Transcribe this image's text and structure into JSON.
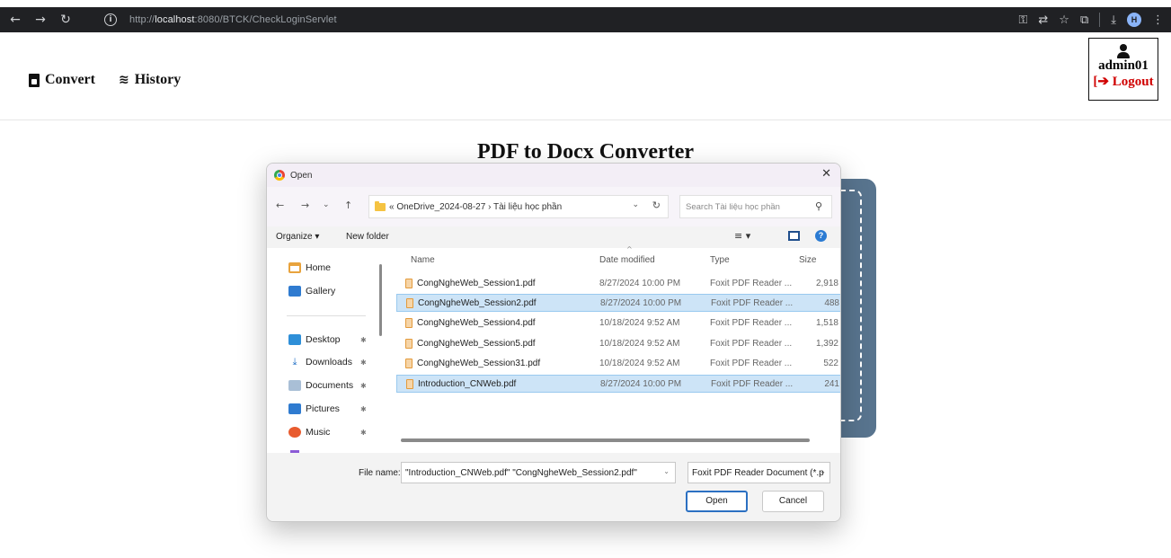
{
  "browser": {
    "url_prefix": "http://",
    "url_host": "localhost",
    "url_rest": ":8080/BTCK/CheckLoginServlet",
    "profile_initial": "H"
  },
  "nav": {
    "convert_label": "Convert",
    "history_label": "History"
  },
  "user": {
    "username": "admin01",
    "logout_label": "Logout"
  },
  "page": {
    "title": "PDF to Docx Converter"
  },
  "dialog": {
    "title": "Open",
    "path": "« OneDrive_2024-08-27 › Tài liệu học phần",
    "search_placeholder": "Search Tài liệu học phần",
    "organize_label": "Organize ▾",
    "new_folder_label": "New folder",
    "sidebar": [
      {
        "label": "Home",
        "icon": "home-icon"
      },
      {
        "label": "Gallery",
        "icon": "gallery-icon"
      },
      {
        "label": "Desktop",
        "icon": "desktop-icon"
      },
      {
        "label": "Downloads",
        "icon": "downloads-icon"
      },
      {
        "label": "Documents",
        "icon": "documents-icon"
      },
      {
        "label": "Pictures",
        "icon": "pictures-icon"
      },
      {
        "label": "Music",
        "icon": "music-icon"
      }
    ],
    "columns": {
      "name": "Name",
      "date": "Date modified",
      "type": "Type",
      "size": "Size"
    },
    "files": [
      {
        "name": "CongNgheWeb_Session1.pdf",
        "date": "8/27/2024 10:00 PM",
        "type": "Foxit PDF Reader ...",
        "size": "2,918",
        "selected": false
      },
      {
        "name": "CongNgheWeb_Session2.pdf",
        "date": "8/27/2024 10:00 PM",
        "type": "Foxit PDF Reader ...",
        "size": "488",
        "selected": true
      },
      {
        "name": "CongNgheWeb_Session4.pdf",
        "date": "10/18/2024 9:52 AM",
        "type": "Foxit PDF Reader ...",
        "size": "1,518",
        "selected": false
      },
      {
        "name": "CongNgheWeb_Session5.pdf",
        "date": "10/18/2024 9:52 AM",
        "type": "Foxit PDF Reader ...",
        "size": "1,392",
        "selected": false
      },
      {
        "name": "CongNgheWeb_Session31.pdf",
        "date": "10/18/2024 9:52 AM",
        "type": "Foxit PDF Reader ...",
        "size": "522",
        "selected": false
      },
      {
        "name": "Introduction_CNWeb.pdf",
        "date": "8/27/2024 10:00 PM",
        "type": "Foxit PDF Reader ...",
        "size": "241",
        "selected": true
      }
    ],
    "file_name_label": "File name:",
    "file_name_value": "\"Introduction_CNWeb.pdf\" \"CongNgheWeb_Session2.pdf\"",
    "file_type_value": "Foxit PDF Reader Document (*.p",
    "open_label": "Open",
    "cancel_label": "Cancel"
  },
  "colors": {
    "card": "#58748e",
    "selection": "#cde4f7",
    "logout": "#d00000",
    "browser_chrome": "#202124"
  }
}
